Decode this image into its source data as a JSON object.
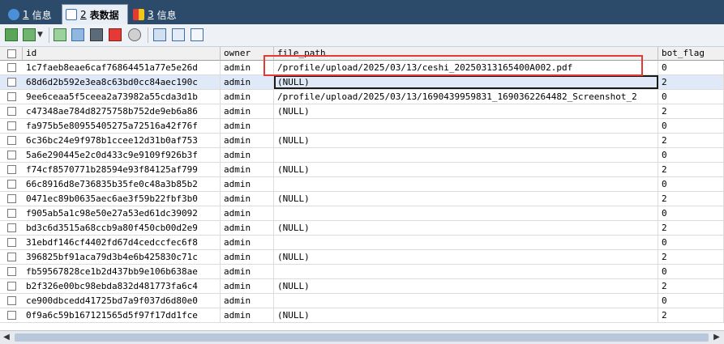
{
  "tabs": [
    {
      "num": "1",
      "label": "信息",
      "active": false,
      "icon": "info-icon"
    },
    {
      "num": "2",
      "label": "表数据",
      "active": true,
      "icon": "table-data-icon"
    },
    {
      "num": "3",
      "label": "信息",
      "active": false,
      "icon": "info-icon"
    }
  ],
  "toolbar": {
    "icons": [
      "export-grid-icon",
      "import-dropdown-icon",
      "add-row-icon",
      "duplicate-row-icon",
      "save-icon",
      "delete-icon",
      "cancel-icon",
      "grid-view-icon",
      "form-view-icon",
      "text-view-icon"
    ]
  },
  "grid": {
    "columns": [
      "id",
      "owner",
      "file_path",
      "bot_flag"
    ],
    "rows": [
      {
        "id": "1c7faeb8eae6caf76864451a77e5e26d",
        "owner": "admin",
        "file_path": "/profile/upload/2025/03/13/ceshi_20250313165400A002.pdf",
        "bot_flag": "0"
      },
      {
        "id": "68d6d2b592e3ea8c63bd0cc84aec190c",
        "owner": "admin",
        "file_path": "(NULL)",
        "bot_flag": "2"
      },
      {
        "id": "9ee6ceaa5f5ceea2a73982a55cda3d1b",
        "owner": "admin",
        "file_path": "/profile/upload/2025/03/13/1690439959831_1690362264482_Screenshot_2",
        "bot_flag": "0"
      },
      {
        "id": "c47348ae784d8275758b752de9eb6a86",
        "owner": "admin",
        "file_path": "(NULL)",
        "bot_flag": "2"
      },
      {
        "id": "fa975b5e80955405275a72516a42f76f",
        "owner": "admin",
        "file_path": "",
        "bot_flag": "0"
      },
      {
        "id": "6c36bc24e9f978b1ccee12d31b0af753",
        "owner": "admin",
        "file_path": "(NULL)",
        "bot_flag": "2"
      },
      {
        "id": "5a6e290445e2c0d433c9e9109f926b3f",
        "owner": "admin",
        "file_path": "",
        "bot_flag": "0"
      },
      {
        "id": "f74cf8570771b28594e93f84125af799",
        "owner": "admin",
        "file_path": "(NULL)",
        "bot_flag": "2"
      },
      {
        "id": "66c8916d8e736835b35fe0c48a3b85b2",
        "owner": "admin",
        "file_path": "",
        "bot_flag": "0"
      },
      {
        "id": "0471ec89b0635aec6ae3f59b22fbf3b0",
        "owner": "admin",
        "file_path": "(NULL)",
        "bot_flag": "2"
      },
      {
        "id": "f905ab5a1c98e50e27a53ed61dc39092",
        "owner": "admin",
        "file_path": "",
        "bot_flag": "0"
      },
      {
        "id": "bd3c6d3515a68ccb9a80f450cb00d2e9",
        "owner": "admin",
        "file_path": "(NULL)",
        "bot_flag": "2"
      },
      {
        "id": "31ebdf146cf4402fd67d4cedccfec6f8",
        "owner": "admin",
        "file_path": "",
        "bot_flag": "0"
      },
      {
        "id": "396825bf91aca79d3b4e6b425830c71c",
        "owner": "admin",
        "file_path": "(NULL)",
        "bot_flag": "2"
      },
      {
        "id": "fb59567828ce1b2d437bb9e106b638ae",
        "owner": "admin",
        "file_path": "",
        "bot_flag": "0"
      },
      {
        "id": "b2f326e00bc98ebda832d481773fa6c4",
        "owner": "admin",
        "file_path": "(NULL)",
        "bot_flag": "2"
      },
      {
        "id": "ce900dbcedd41725bd7a9f037d6d80e0",
        "owner": "admin",
        "file_path": "",
        "bot_flag": "0"
      },
      {
        "id": "0f9a6c59b167121565d5f97f17dd1fce",
        "owner": "admin",
        "file_path": "(NULL)",
        "bot_flag": "2"
      }
    ]
  },
  "colors": {
    "tabbar": "#2c4a6a",
    "highlight": "#e53935",
    "selected_row": "#dfe9f7"
  }
}
